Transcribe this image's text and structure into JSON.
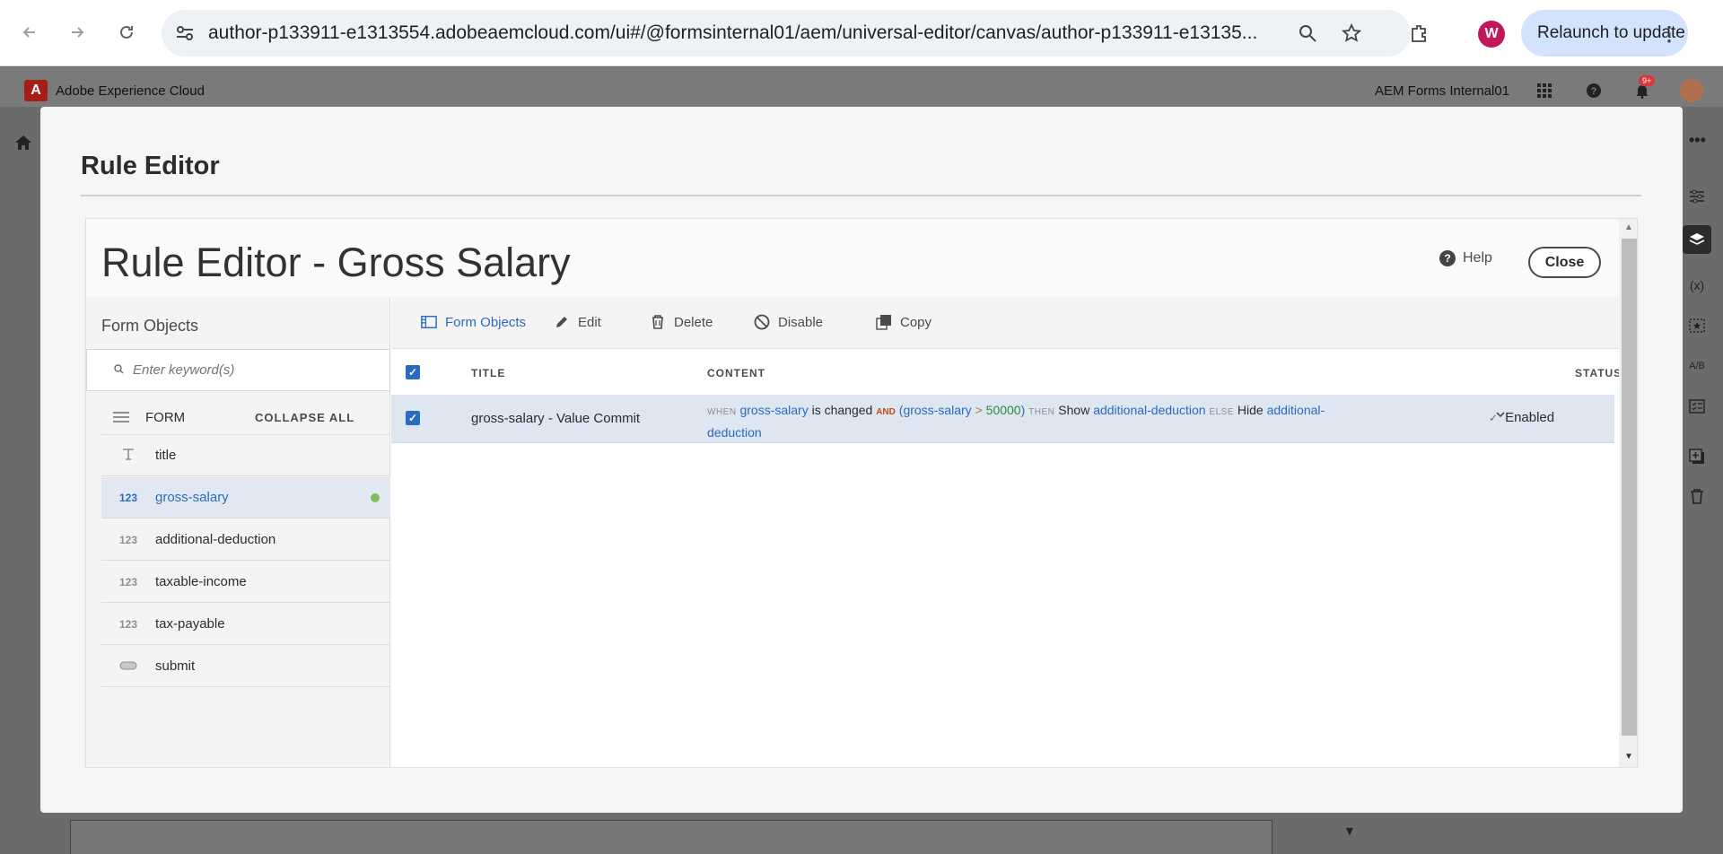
{
  "browser": {
    "url": "author-p133911-e1313554.adobeaemcloud.com/ui#/@formsinternal01/aem/universal-editor/canvas/author-p133911-e13135...",
    "profile_initial": "W",
    "relaunch_label": "Relaunch to update"
  },
  "shell": {
    "app_title": "Adobe Experience Cloud",
    "org": "AEM Forms Internal01",
    "notification_badge": "9+"
  },
  "dialog": {
    "title": "Rule Editor",
    "editor_title": "Rule Editor - Gross Salary",
    "help_label": "Help",
    "close_label": "Close"
  },
  "left_panel": {
    "title": "Form Objects",
    "search_placeholder": "Enter keyword(s)",
    "root_label": "FORM",
    "collapse_label": "COLLAPSE ALL",
    "items": [
      {
        "icon": "T",
        "label": "title"
      },
      {
        "icon": "123",
        "label": "gross-salary",
        "selected": true
      },
      {
        "icon": "123",
        "label": "additional-deduction"
      },
      {
        "icon": "123",
        "label": "taxable-income"
      },
      {
        "icon": "123",
        "label": "tax-payable"
      },
      {
        "icon": "button",
        "label": "submit"
      }
    ]
  },
  "toolbar": {
    "form_objects": "Form Objects",
    "edit": "Edit",
    "delete": "Delete",
    "disable": "Disable",
    "copy": "Copy"
  },
  "table": {
    "headers": {
      "title": "TITLE",
      "content": "CONTENT",
      "status": "STATUS"
    },
    "rows": [
      {
        "title": "gross-salary - Value Commit",
        "content": {
          "when": "WHEN",
          "var1": "gross-salary",
          "changed": "is changed",
          "and": "AND",
          "open": "(",
          "var2": "gross-salary",
          "op": ">",
          "value": "50000",
          "close": ")",
          "then": "THEN",
          "show": "Show",
          "target1": "additional-deduction",
          "else": "ELSE",
          "hide": "Hide",
          "target2a": "additional-",
          "target2b": "deduction"
        },
        "status": "Enabled"
      }
    ]
  },
  "colors": {
    "accent": "#2b6bbf",
    "selected_row": "#dde6f1",
    "status_dot": "#7fbf5a",
    "and_keyword": "#c44e12"
  }
}
